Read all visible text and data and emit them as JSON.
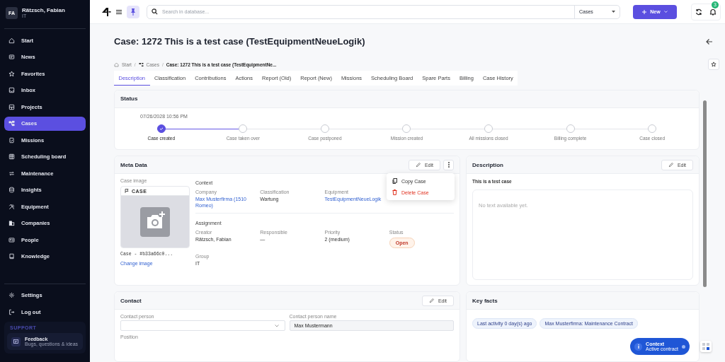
{
  "user": {
    "initials": "FA",
    "name": "Rätzsch, Fabian",
    "group": "IT"
  },
  "nav": [
    {
      "label": "Start",
      "selected": false
    },
    {
      "label": "News",
      "selected": false
    },
    {
      "label": "Favorites",
      "selected": false
    },
    {
      "label": "Inbox",
      "selected": false
    },
    {
      "label": "Projects",
      "selected": false
    },
    {
      "label": "Cases",
      "selected": true
    },
    {
      "label": "Missions",
      "selected": false
    },
    {
      "label": "Scheduling board",
      "selected": false
    },
    {
      "label": "Maintenance",
      "selected": false
    },
    {
      "label": "Insights",
      "selected": false
    },
    {
      "label": "Equipment",
      "selected": false
    },
    {
      "label": "Companies",
      "selected": false
    },
    {
      "label": "People",
      "selected": false
    },
    {
      "label": "Knowledge",
      "selected": false
    }
  ],
  "footer_nav": [
    {
      "label": "Settings"
    },
    {
      "label": "Log out"
    }
  ],
  "support": {
    "heading": "SUPPORT",
    "title": "Feedback",
    "subtitle": "Bugs, questions & ideas"
  },
  "topbar": {
    "search_placeholder": "Search in database...",
    "scope": "Cases",
    "new_button": "New",
    "notification_count": "3"
  },
  "page": {
    "title": "Case: 1272 This is a test case (TestEquipmentNeueLogik)",
    "breadcrumb_separator": "/",
    "breadcrumb": [
      "Start",
      "Cases",
      "Case: 1272 This is a test case (TestEquipmentNe..."
    ],
    "tabs": [
      {
        "label": "Description",
        "selected": true
      },
      {
        "label": "Classification",
        "selected": false
      },
      {
        "label": "Contributions",
        "selected": false
      },
      {
        "label": "Actions",
        "selected": false
      },
      {
        "label": "Report (Old)",
        "selected": false
      },
      {
        "label": "Report (New)",
        "selected": false
      },
      {
        "label": "Missions",
        "selected": false
      },
      {
        "label": "Scheduling Board",
        "selected": false
      },
      {
        "label": "Spare Parts",
        "selected": false
      },
      {
        "label": "Billing",
        "selected": false
      },
      {
        "label": "Case History",
        "selected": false
      }
    ]
  },
  "status": {
    "title": "Status",
    "date": "07/26/2028 10:56 PM",
    "steps": [
      {
        "label": "Case created",
        "done": true
      },
      {
        "label": "Case taken over",
        "done": false
      },
      {
        "label": "Case postponed",
        "done": false
      },
      {
        "label": "Mission created",
        "done": false
      },
      {
        "label": "All missions closed",
        "done": false
      },
      {
        "label": "Billing complete",
        "done": false
      },
      {
        "label": "Case closed",
        "done": false
      }
    ]
  },
  "meta": {
    "title": "Meta Data",
    "edit": "Edit",
    "menu": [
      {
        "label": "Copy Case",
        "kind": "normal"
      },
      {
        "label": "Delete Case",
        "kind": "danger"
      }
    ],
    "image_label": "Case image",
    "image_tag": "CASE",
    "image_id": "Case - #b33a66c0...",
    "change_image": "Change image",
    "sections": [
      {
        "heading": "Context",
        "fields": [
          {
            "label": "Company",
            "value": "Max Musterfirma (1510 Romeo)",
            "kind": "link"
          },
          {
            "label": "Classification",
            "value": "Wartung",
            "kind": "text"
          },
          {
            "label": "Equipment",
            "value": "TestEquipmentNeueLogik",
            "kind": "link"
          }
        ]
      },
      {
        "heading": "Assignment",
        "fields": [
          {
            "label": "Creator",
            "value": "Rätzsch, Fabian",
            "kind": "text"
          },
          {
            "label": "Responsible",
            "value": "—",
            "kind": "text"
          },
          {
            "label": "Priority",
            "value": "2 (medium)",
            "kind": "text"
          },
          {
            "label": "Status",
            "value": "Open",
            "kind": "badge"
          },
          {
            "label": "Group",
            "value": "IT",
            "kind": "text"
          }
        ]
      }
    ]
  },
  "description": {
    "title": "Description",
    "edit": "Edit",
    "subtitle": "This is a test case",
    "placeholder": "No text available yet."
  },
  "contact": {
    "title": "Contact",
    "edit": "Edit",
    "contact_person_label": "Contact person",
    "name_label": "Contact person name",
    "name_value": "Max Mustermann",
    "position_label": "Position"
  },
  "key_facts": {
    "title": "Key facts",
    "chips": [
      "Last activity 0 day(s) ago",
      "Max Musterfirma: Maintenance Contract"
    ]
  },
  "context_button": {
    "title": "Context",
    "subtitle": "Active contract"
  }
}
